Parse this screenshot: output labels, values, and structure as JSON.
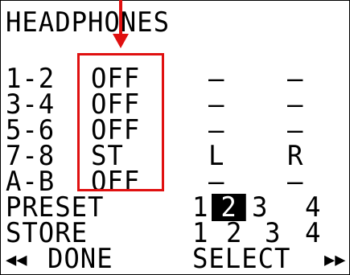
{
  "title": "HEADPHONES",
  "channels": [
    {
      "id": "1-2",
      "mode": "OFF",
      "left": "–",
      "right": "–"
    },
    {
      "id": "3-4",
      "mode": "OFF",
      "left": "–",
      "right": "–"
    },
    {
      "id": "5-6",
      "mode": "OFF",
      "left": "–",
      "right": "–"
    },
    {
      "id": "7-8",
      "mode": "ST",
      "left": "L",
      "right": "R"
    },
    {
      "id": "A-B",
      "mode": "OFF",
      "left": "–",
      "right": "–"
    }
  ],
  "preset": {
    "label": "PRESET",
    "options": [
      "1",
      "2",
      "3",
      "4"
    ],
    "selected": "2"
  },
  "store": {
    "label": "STORE",
    "options": [
      "1",
      "2",
      "3",
      "4"
    ]
  },
  "softkeys": {
    "left_label": "DONE",
    "right_label": "SELECT",
    "left_icon": "rewind-icon",
    "right_icon": "fast-forward-icon"
  },
  "annotation_color": "#e01010"
}
